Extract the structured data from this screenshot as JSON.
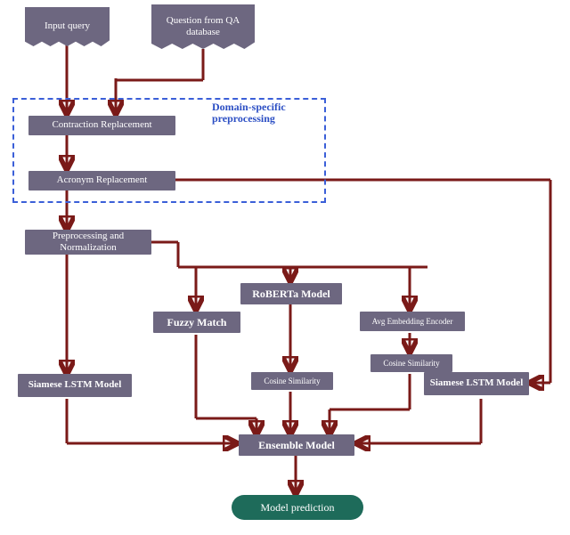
{
  "inputs": {
    "input_query": "Input query",
    "qa_question": "Question from QA database"
  },
  "region": {
    "label": "Domain-specific preprocessing"
  },
  "steps": {
    "contraction": "Contraction Replacement",
    "acronym": "Acronym Replacement",
    "preproc_norm": "Preprocessing and Normalization",
    "roberta": "RoBERTa Model",
    "fuzzy": "Fuzzy Match",
    "avg_embed": "Avg Embedding Encoder",
    "cos_sim_1": "Cosine Similarity",
    "cos_sim_2": "Cosine Similarity",
    "siamese_left": "Siamese LSTM Model",
    "siamese_right": "Siamese LSTM Model",
    "ensemble": "Ensemble Model"
  },
  "output": {
    "prediction": "Model prediction"
  },
  "chart_data": {
    "type": "flowchart",
    "nodes": [
      {
        "id": "input_query",
        "label": "Input query",
        "shape": "document"
      },
      {
        "id": "qa_question",
        "label": "Question from QA database",
        "shape": "document"
      },
      {
        "id": "contraction",
        "label": "Contraction Replacement",
        "shape": "rect",
        "group": "domain_preprocessing"
      },
      {
        "id": "acronym",
        "label": "Acronym Replacement",
        "shape": "rect",
        "group": "domain_preprocessing"
      },
      {
        "id": "preproc_norm",
        "label": "Preprocessing and Normalization",
        "shape": "rect"
      },
      {
        "id": "roberta",
        "label": "RoBERTa Model",
        "shape": "rect"
      },
      {
        "id": "fuzzy",
        "label": "Fuzzy Match",
        "shape": "rect"
      },
      {
        "id": "avg_embed",
        "label": "Avg Embedding Encoder",
        "shape": "rect"
      },
      {
        "id": "cos_sim_roberta",
        "label": "Cosine Similarity",
        "shape": "rect"
      },
      {
        "id": "cos_sim_embed",
        "label": "Cosine Similarity",
        "shape": "rect"
      },
      {
        "id": "siamese_left",
        "label": "Siamese LSTM Model",
        "shape": "rect"
      },
      {
        "id": "siamese_right",
        "label": "Siamese LSTM Model",
        "shape": "rect"
      },
      {
        "id": "ensemble",
        "label": "Ensemble Model",
        "shape": "rect"
      },
      {
        "id": "prediction",
        "label": "Model prediction",
        "shape": "terminator"
      }
    ],
    "groups": [
      {
        "id": "domain_preprocessing",
        "label": "Domain-specific preprocessing",
        "members": [
          "contraction",
          "acronym"
        ]
      }
    ],
    "edges": [
      {
        "from": "input_query",
        "to": "contraction"
      },
      {
        "from": "qa_question",
        "to": "contraction"
      },
      {
        "from": "contraction",
        "to": "acronym"
      },
      {
        "from": "acronym",
        "to": "preproc_norm"
      },
      {
        "from": "acronym",
        "to": "siamese_right"
      },
      {
        "from": "preproc_norm",
        "to": "siamese_left"
      },
      {
        "from": "preproc_norm",
        "to": "fuzzy"
      },
      {
        "from": "preproc_norm",
        "to": "roberta"
      },
      {
        "from": "preproc_norm",
        "to": "avg_embed"
      },
      {
        "from": "roberta",
        "to": "cos_sim_roberta"
      },
      {
        "from": "avg_embed",
        "to": "cos_sim_embed"
      },
      {
        "from": "siamese_left",
        "to": "ensemble"
      },
      {
        "from": "fuzzy",
        "to": "ensemble"
      },
      {
        "from": "cos_sim_roberta",
        "to": "ensemble"
      },
      {
        "from": "cos_sim_embed",
        "to": "ensemble"
      },
      {
        "from": "siamese_right",
        "to": "ensemble"
      },
      {
        "from": "ensemble",
        "to": "prediction"
      }
    ]
  }
}
